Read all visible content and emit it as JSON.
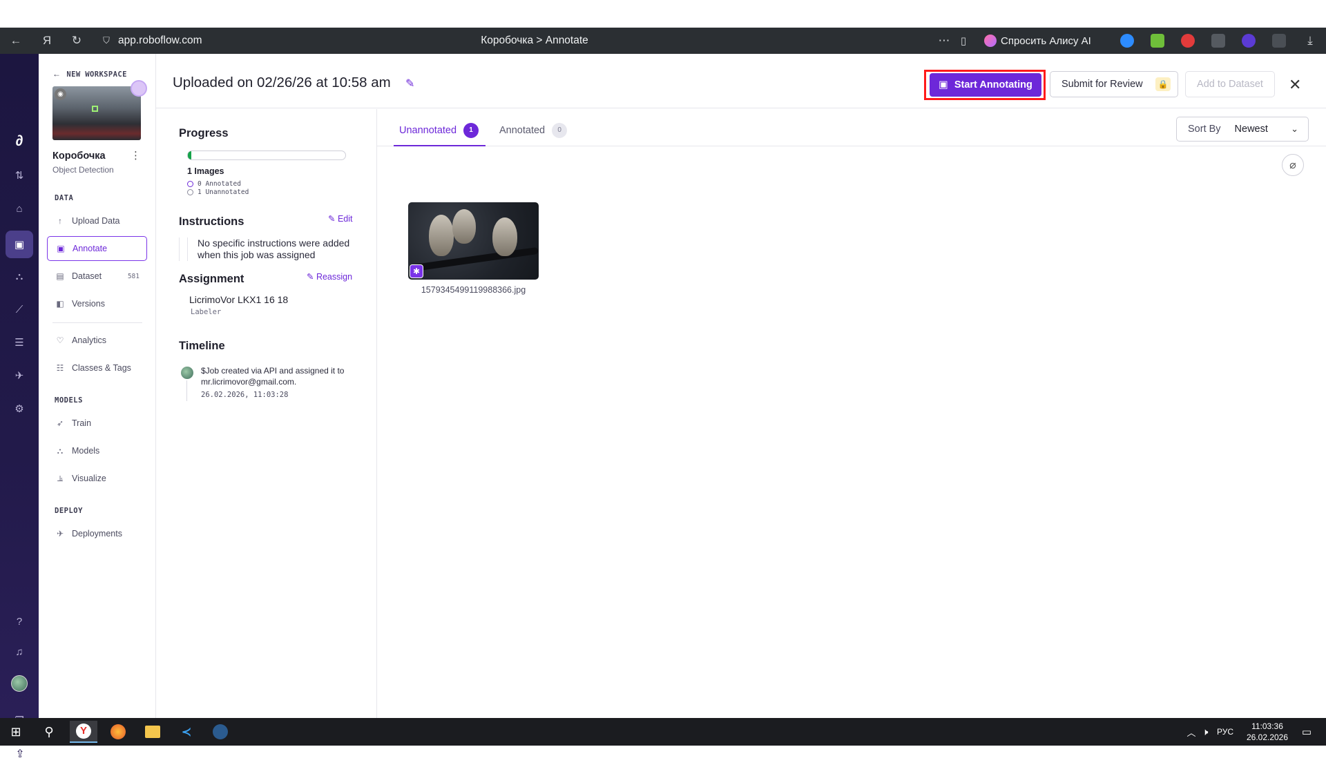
{
  "browser": {
    "url": "app.roboflow.com",
    "tab_title": "Коробочка > Annotate",
    "alice_label": "Спросить Алису AI",
    "more": "⋯"
  },
  "project": {
    "back_label": "NEW WORKSPACE",
    "name": "Коробочка",
    "type": "Object Detection"
  },
  "sidebar": {
    "data_section": "DATA",
    "upload": "Upload Data",
    "annotate": "Annotate",
    "dataset": "Dataset",
    "dataset_count": "581",
    "versions": "Versions",
    "analytics": "Analytics",
    "classes": "Classes & Tags",
    "models_section": "MODELS",
    "train": "Train",
    "models": "Models",
    "visualize": "Visualize",
    "deploy_section": "DEPLOY",
    "deployments": "Deployments"
  },
  "header": {
    "title": "Uploaded on 02/26/26 at 10:58 am",
    "start_annotating": "Start Annotating",
    "submit_review": "Submit for Review",
    "add_dataset": "Add to Dataset"
  },
  "progress": {
    "heading": "Progress",
    "fraction": 0.02,
    "images": "1 Images",
    "annotated": "0 Annotated",
    "unannotated": "1 Unannotated"
  },
  "instructions": {
    "heading": "Instructions",
    "edit": "Edit",
    "text": "No specific instructions were added when this job was assigned"
  },
  "assignment": {
    "heading": "Assignment",
    "reassign": "Reassign",
    "name": "LicrimoVor LKX1 16 18",
    "role": "Labeler"
  },
  "timeline": {
    "heading": "Timeline",
    "event": "$Job created via API and assigned it to mr.licrimovor@gmail.com.",
    "date": "26.02.2026, 11:03:28"
  },
  "tabs": {
    "unannotated": "Unannotated",
    "unannotated_count": "1",
    "annotated": "Annotated",
    "annotated_count": "0"
  },
  "sort": {
    "label": "Sort By",
    "value": "Newest"
  },
  "images": [
    {
      "filename": "1579345499119988366.jpg"
    }
  ],
  "taskbar": {
    "lang": "РУС",
    "time": "11:03:36",
    "date": "26.02.2026"
  },
  "colors": {
    "accent": "#6d28d9",
    "highlight": "#ff1a1a",
    "rail": "#1c1640",
    "progress": "#16a34a"
  }
}
